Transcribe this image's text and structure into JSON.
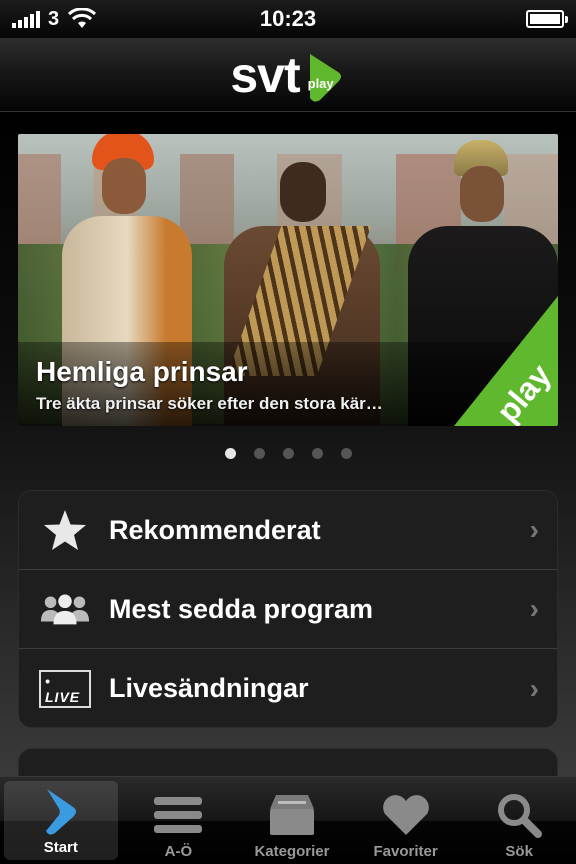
{
  "status_bar": {
    "carrier": "3",
    "time": "10:23",
    "signal_bars": 5,
    "battery_level": 1.0
  },
  "header": {
    "logo_text": "svt",
    "logo_badge_text": "play"
  },
  "hero": {
    "title": "Hemliga prinsar",
    "subtitle": "Tre äkta prinsar söker efter den stora kär…",
    "corner_label": "play",
    "corner_color": "#5fb82d"
  },
  "pagination": {
    "total": 5,
    "active_index": 0
  },
  "menu": {
    "items": [
      {
        "label": "Rekommenderat",
        "icon": "star-icon"
      },
      {
        "label": "Mest sedda program",
        "icon": "people-icon"
      },
      {
        "label": "Livesändningar",
        "icon": "live-icon",
        "badge": "• LIVE"
      }
    ]
  },
  "tab_bar": {
    "tabs": [
      {
        "label": "Start",
        "icon": "svt-play-icon",
        "active": true
      },
      {
        "label": "A-Ö",
        "icon": "list-icon",
        "active": false
      },
      {
        "label": "Kategorier",
        "icon": "box-icon",
        "active": false
      },
      {
        "label": "Favoriter",
        "icon": "heart-icon",
        "active": false
      },
      {
        "label": "Sök",
        "icon": "search-icon",
        "active": false
      }
    ]
  },
  "colors": {
    "brand_green": "#5fb82d",
    "active_tab_blue": "#3a9be0"
  }
}
